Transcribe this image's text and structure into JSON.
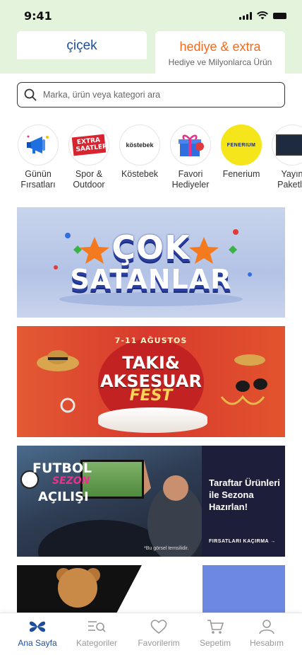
{
  "status_bar": {
    "time": "9:41"
  },
  "top_tabs": {
    "cicek": {
      "label": "çiçek"
    },
    "hediye": {
      "label": "hediye & extra",
      "subtitle": "Hediye ve Milyonlarca Ürün"
    }
  },
  "search": {
    "placeholder": "Marka, ürün veya kategori ara"
  },
  "categories": [
    {
      "label_line1": "Günün",
      "label_line2": "Fırsatları",
      "icon": "megaphone-icon"
    },
    {
      "label_line1": "Spor &",
      "label_line2": "Outdoor",
      "icon": "extra-saatler-logo",
      "logo_text": "EXTRA SAATLER"
    },
    {
      "label_line1": "Köstebek",
      "label_line2": "",
      "icon": "kostebek-logo",
      "logo_text": "köstebek"
    },
    {
      "label_line1": "Favori",
      "label_line2": "Hediyeler",
      "icon": "gift-box-icon"
    },
    {
      "label_line1": "Fenerium",
      "label_line2": "",
      "icon": "fenerium-logo",
      "logo_text": "FENERIUM"
    },
    {
      "label_line1": "Yayın",
      "label_line2": "Paketle",
      "icon": "tv-package-icon"
    }
  ],
  "banners": {
    "cok_satanlar": {
      "line1": "ÇOK",
      "line2": "SATANLAR"
    },
    "taki_aksesuar": {
      "date": "7-11 AĞUSTOS",
      "line1": "TAKI&",
      "line2": "AKSESUAR",
      "line3": "FEST"
    },
    "futbol": {
      "line1": "FUTBOL",
      "line2": "SEZON",
      "line3": "AÇILIŞI",
      "panel_text": "Taraftar Ürünleri ile Sezona Hazırlan!",
      "cta": "FIRSATLARI KAÇIRMA",
      "note": "*Bu görsel temsilidir."
    }
  },
  "bottom_nav": [
    {
      "label": "Ana Sayfa",
      "active": true
    },
    {
      "label": "Kategoriler",
      "active": false
    },
    {
      "label": "Favorilerim",
      "active": false
    },
    {
      "label": "Sepetim",
      "active": false
    },
    {
      "label": "Hesabım",
      "active": false
    }
  ],
  "colors": {
    "brand_blue": "#1f4d9c",
    "accent_orange": "#f26b21",
    "header_green": "#e3f3dc",
    "fenerium_yellow": "#f5e51b"
  }
}
